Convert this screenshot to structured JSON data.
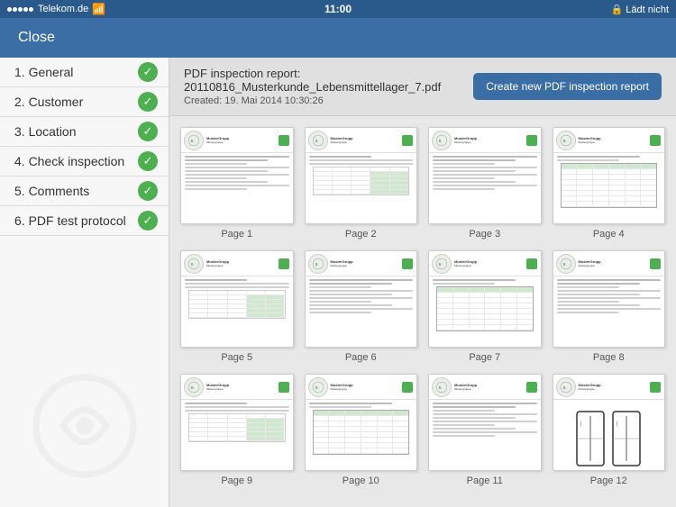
{
  "statusBar": {
    "carrier": "Telekom.de",
    "time": "11:00",
    "battery": "Lädt nicht"
  },
  "header": {
    "closeLabel": "Close"
  },
  "sidebar": {
    "items": [
      {
        "id": "general",
        "number": "1",
        "label": "General",
        "checked": true
      },
      {
        "id": "customer",
        "number": "2",
        "label": "Customer",
        "checked": true
      },
      {
        "id": "location",
        "number": "3",
        "label": "Location",
        "checked": true
      },
      {
        "id": "check-inspection",
        "number": "4",
        "label": "Check inspection",
        "checked": true
      },
      {
        "id": "comments",
        "number": "5",
        "label": "Comments",
        "checked": true
      },
      {
        "id": "pdf-test-protocol",
        "number": "6",
        "label": "PDF test protocol",
        "checked": true
      }
    ]
  },
  "content": {
    "reportTitle": "PDF inspection report: 20110816_Musterkunde_Lebensmittellager_7.pdf",
    "createdLabel": "Created: 19. Mai 2014 10:30:26",
    "createButtonLabel": "Create new PDF inspection report",
    "pages": [
      {
        "label": "Page  1"
      },
      {
        "label": "Page  2"
      },
      {
        "label": "Page  3"
      },
      {
        "label": "Page  4"
      },
      {
        "label": "Page  5"
      },
      {
        "label": "Page  6"
      },
      {
        "label": "Page  7"
      },
      {
        "label": "Page  8"
      },
      {
        "label": "Page  9"
      },
      {
        "label": "Page  10"
      },
      {
        "label": "Page  11"
      },
      {
        "label": "Page  12"
      }
    ]
  }
}
